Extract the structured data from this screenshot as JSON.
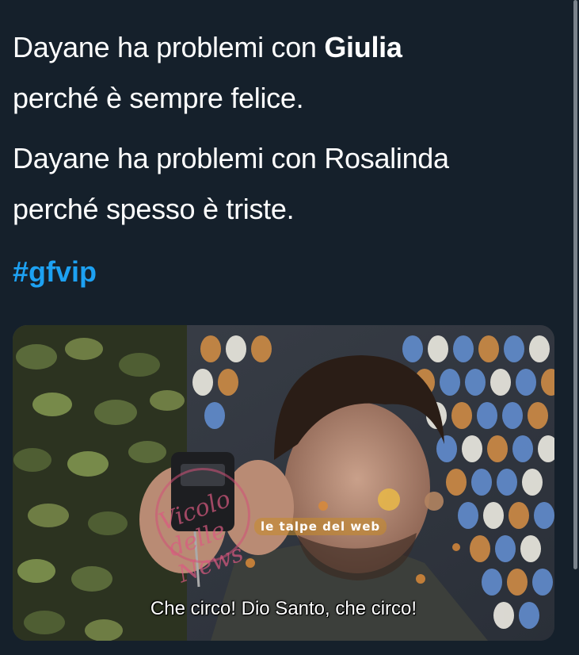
{
  "tweet": {
    "paragraph1": {
      "part1": "Dayane ha problemi con ",
      "bold_name": "Giulia",
      "part2": "perché è sempre felice."
    },
    "paragraph2": {
      "line1": "Dayane ha problemi con Rosalinda",
      "line2": "perché spesso è triste."
    },
    "hashtag": "#gfvip"
  },
  "media": {
    "caption": "Che circo! Dio Santo, che circo!",
    "watermark_left": "Vicolo delle News",
    "watermark_right": "le talpe del web"
  },
  "colors": {
    "background": "#15202b",
    "text": "#ffffff",
    "hashtag": "#1da1f2"
  }
}
